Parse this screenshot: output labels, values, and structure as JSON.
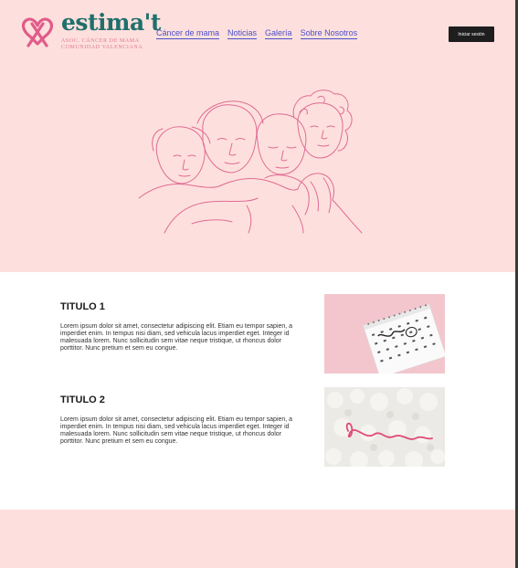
{
  "logo": {
    "wordmark": "estima't",
    "subtitle_line1": "ASOC. CÁNCER DE MAMA",
    "subtitle_line2": "COMUNIDAD VALENCIANA"
  },
  "nav": {
    "items": [
      {
        "label": "Cáncer de mama"
      },
      {
        "label": "Noticias"
      },
      {
        "label": "Galería"
      },
      {
        "label": "Sobre Nosotros"
      }
    ]
  },
  "header": {
    "login_label": "Iniciar sesión"
  },
  "colors": {
    "hero_bg": "#fde0dd",
    "accent_pink": "#e05c8a",
    "brand_teal": "#1f6f6c",
    "nav_link": "#4b4fc8"
  },
  "sections": [
    {
      "title": "TITULO 1",
      "body": "Lorem ipsum dolor sit amet, consectetur adipiscing elit. Etiam eu tempor sapien, a imperdiet enim. In tempus nisi diam, sed vehicula lacus imperdiet eget. Integer id malesuada lorem. Nunc sollicitudin sem vitae neque tristique, ut rhoncus dolor porttitor. Nunc pretium et sem eu congue.",
      "image": "calendar-photo"
    },
    {
      "title": "TITULO 2",
      "body": "Lorem ipsum dolor sit amet, consectetur adipiscing elit. Etiam eu tempor sapien, a imperdiet enim. In tempus nisi diam, sed vehicula lacus imperdiet eget. Integer id malesuada lorem. Nunc sollicitudin sem vitae neque tristique, ut rhoncus dolor porttitor. Nunc pretium et sem eu congue.",
      "image": "pink-ribbon-photo"
    }
  ]
}
